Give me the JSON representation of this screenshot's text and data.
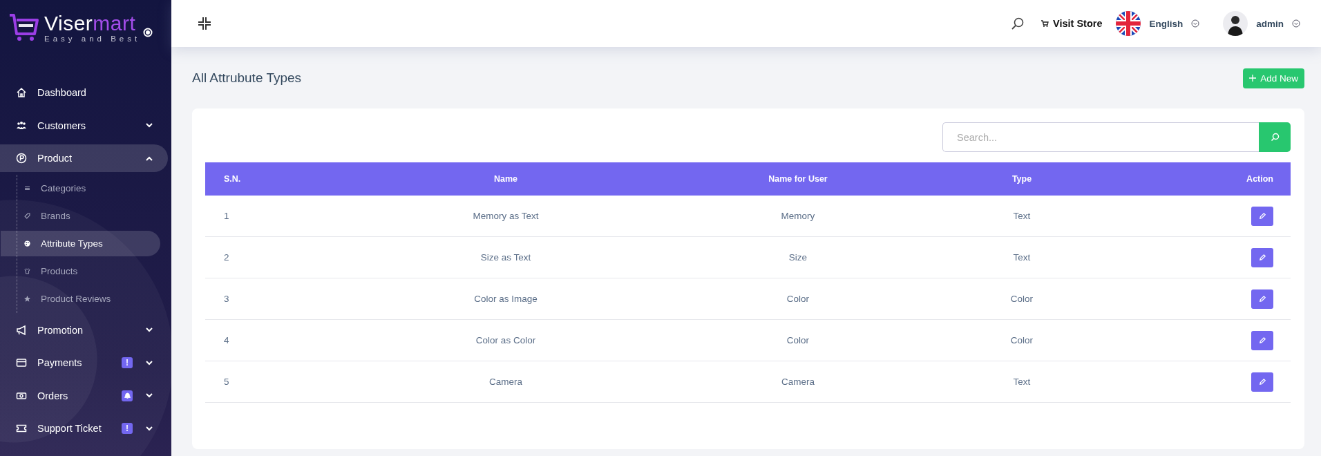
{
  "brand": {
    "name_part1": "Viser",
    "name_part2": "mart",
    "tagline": "Easy and Best"
  },
  "sidebar": {
    "items": [
      {
        "label": "Dashboard",
        "selected": false
      },
      {
        "label": "Customers",
        "selected": false,
        "expanded": false
      },
      {
        "label": "Product",
        "selected": true,
        "expanded": true,
        "children": [
          {
            "label": "Categories",
            "selected": false
          },
          {
            "label": "Brands",
            "selected": false
          },
          {
            "label": "Attribute Types",
            "selected": true
          },
          {
            "label": "Products",
            "selected": false
          },
          {
            "label": "Product Reviews",
            "selected": false
          }
        ]
      },
      {
        "label": "Promotion",
        "selected": false,
        "expanded": false
      },
      {
        "label": "Payments",
        "selected": false,
        "expanded": false,
        "badge": {
          "kind": "text",
          "text": "!"
        }
      },
      {
        "label": "Orders",
        "selected": false,
        "expanded": false,
        "badge": {
          "kind": "bell"
        }
      },
      {
        "label": "Support Ticket",
        "selected": false,
        "expanded": false,
        "badge": {
          "kind": "text",
          "text": "!"
        }
      }
    ]
  },
  "topbar": {
    "visit_store": "Visit Store",
    "language": "English",
    "user": "admin"
  },
  "page": {
    "title": "All Attrubute Types",
    "add_button": "Add New"
  },
  "search": {
    "placeholder": "Search..."
  },
  "table": {
    "columns": [
      "S.N.",
      "Name",
      "Name for User",
      "Type",
      "Action"
    ],
    "rows": [
      {
        "sn": "1",
        "name": "Memory as Text",
        "name_for_user": "Memory",
        "type": "Text"
      },
      {
        "sn": "2",
        "name": "Size as Text",
        "name_for_user": "Size",
        "type": "Text"
      },
      {
        "sn": "3",
        "name": "Color as Image",
        "name_for_user": "Color",
        "type": "Color"
      },
      {
        "sn": "4",
        "name": "Color as Color",
        "name_for_user": "Color",
        "type": "Color"
      },
      {
        "sn": "5",
        "name": "Camera",
        "name_for_user": "Camera",
        "type": "Text"
      }
    ]
  }
}
